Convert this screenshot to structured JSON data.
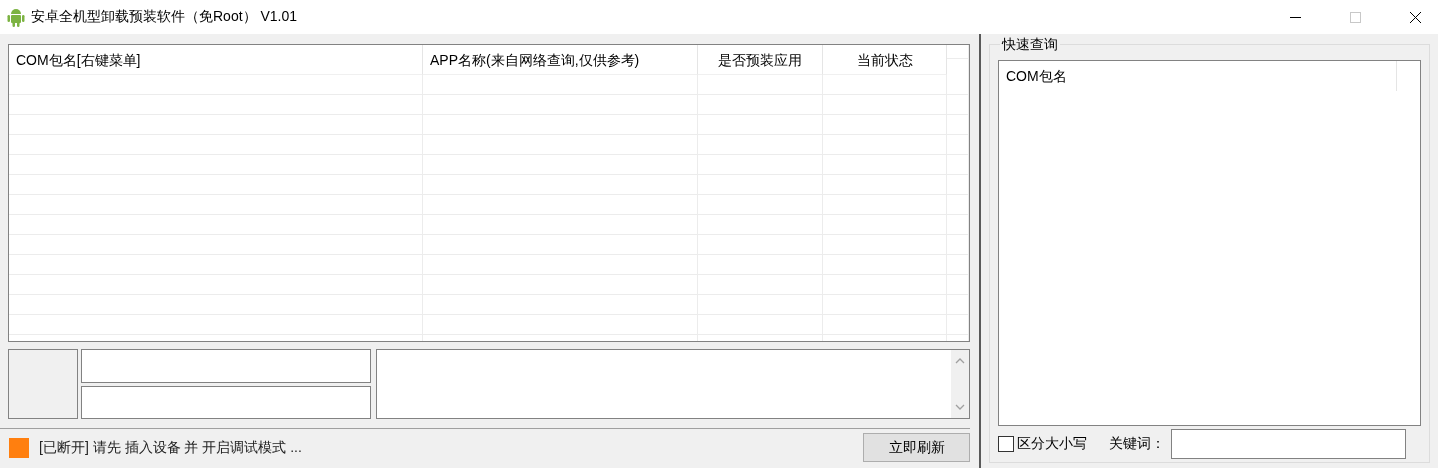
{
  "window": {
    "title": "安卓全机型卸载预装软件（免Root） V1.01",
    "controls": [
      {
        "kind": "minimize",
        "disabled": false
      },
      {
        "kind": "maximize",
        "disabled": true
      },
      {
        "kind": "close",
        "disabled": false
      }
    ]
  },
  "package_table": {
    "columns": [
      "COM包名[右键菜单]",
      "APP名称(来自网络查询,仅供参考)",
      "是否预装应用",
      "当前状态"
    ]
  },
  "status_bar": {
    "connected": false,
    "text": "[已断开] 请先 插入设备 并 开启调试模式 ...",
    "button": "立即刷新"
  },
  "quick_search": {
    "title": "快速查询",
    "list_column": "COM包名",
    "case_sensitive": {
      "label": "区分大小写",
      "checked": false
    },
    "keyword_label": "关键词："
  }
}
